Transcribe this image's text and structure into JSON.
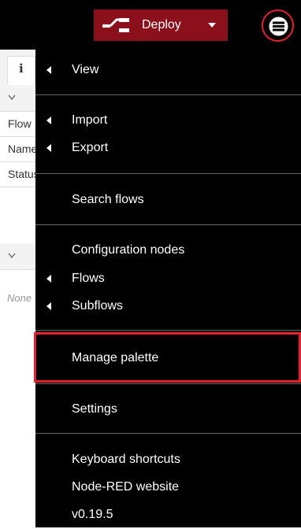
{
  "header": {
    "deploy_label": "Deploy",
    "deploy_color": "#8c101c",
    "menu_icon": "hamburger-menu-icon",
    "highlight_color": "#e8202e"
  },
  "sidebar": {
    "info_tab_glyph": "i",
    "rows": [
      "Flow",
      "Name",
      "Status"
    ],
    "none_text": "None"
  },
  "menu": {
    "items": [
      {
        "label": "View",
        "submenu": true
      },
      {
        "label": "Import",
        "submenu": true
      },
      {
        "label": "Export",
        "submenu": true
      },
      {
        "label": "Search flows",
        "submenu": false
      },
      {
        "label": "Configuration nodes",
        "submenu": false
      },
      {
        "label": "Flows",
        "submenu": true
      },
      {
        "label": "Subflows",
        "submenu": true
      },
      {
        "label": "Manage palette",
        "submenu": false,
        "highlighted": true
      },
      {
        "label": "Settings",
        "submenu": false
      },
      {
        "label": "Keyboard shortcuts",
        "submenu": false
      },
      {
        "label": "Node-RED website",
        "submenu": false
      },
      {
        "label": "v0.19.5",
        "submenu": false
      }
    ]
  }
}
